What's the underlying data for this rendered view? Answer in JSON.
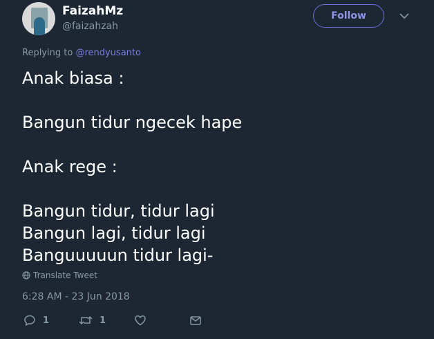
{
  "user": {
    "display_name": "FaizahMz",
    "handle": "@faizahzah"
  },
  "follow_label": "Follow",
  "replying": {
    "prefix": "Replying to",
    "mention": "@rendyusanto"
  },
  "tweet": {
    "lines": [
      "Anak biasa :",
      "",
      "Bangun tidur ngecek hape",
      "",
      "Anak rege :",
      "",
      "Bangun tidur, tidur lagi",
      "Bangun lagi, tidur lagi",
      "Banguuuuun tidur lagi-"
    ]
  },
  "translate_label": "Translate Tweet",
  "timestamp": "6:28 AM - 23 Jun 2018",
  "actions": {
    "reply_count": "1",
    "retweet_count": "1"
  },
  "colors": {
    "background": "#1c2733",
    "secondary_text": "#8899a6",
    "accent": "#7a80e0"
  }
}
